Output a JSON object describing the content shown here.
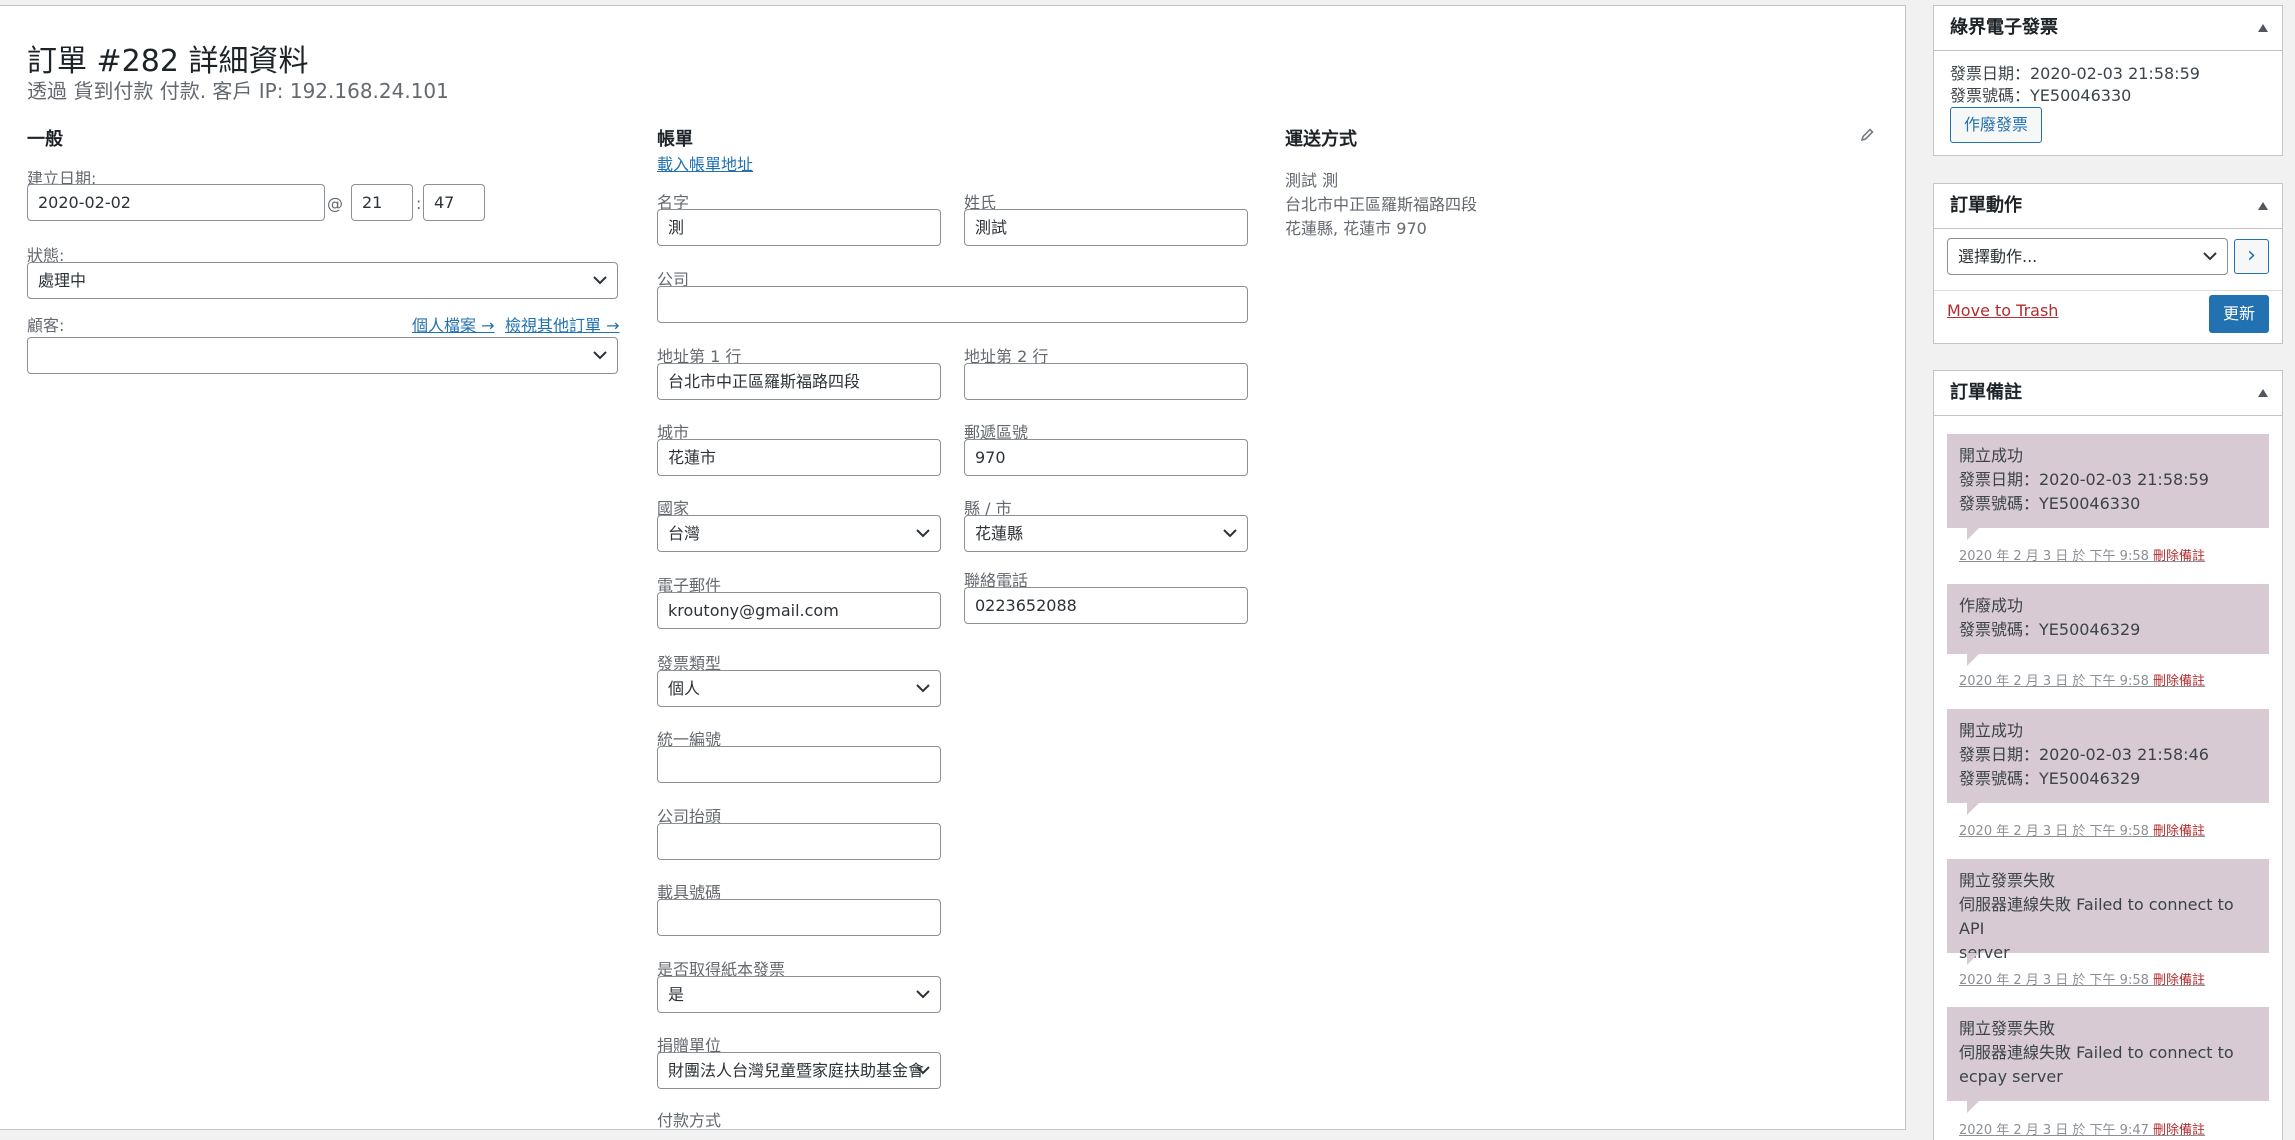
{
  "order": {
    "title": "訂單 #282 詳細資料",
    "subtitle": "透過 貨到付款 付款. 客戶 IP: 192.168.24.101"
  },
  "general": {
    "heading": "一般",
    "created_label": "建立日期:",
    "created_date": "2020-02-02",
    "at": "@",
    "hour": "21",
    "colon": ":",
    "minute": "47",
    "status_label": "狀態:",
    "status_value": "處理中",
    "customer_label": "顧客:",
    "profile_link": "個人檔案 →",
    "other_orders_link": "檢視其他訂單 →",
    "customer_value": ""
  },
  "billing": {
    "heading": "帳單",
    "load_address": "載入帳單地址",
    "first_name_label": "名字",
    "first_name": "測",
    "last_name_label": "姓氏",
    "last_name": "測試",
    "company_label": "公司",
    "company": "",
    "address1_label": "地址第 1 行",
    "address1": "台北市中正區羅斯福路四段",
    "address2_label": "地址第 2 行",
    "address2": "",
    "city_label": "城市",
    "city": "花蓮市",
    "postcode_label": "郵遞區號",
    "postcode": "970",
    "country_label": "國家",
    "country": "台灣",
    "state_label": "縣 / 市",
    "state": "花蓮縣",
    "email_label": "電子郵件",
    "email": "kroutony@gmail.com",
    "phone_label": "聯絡電話",
    "phone": "0223652088",
    "invoice_type_label": "發票類型",
    "invoice_type": "個人",
    "tax_id_label": "統一編號",
    "tax_id": "",
    "company_title_label": "公司抬頭",
    "company_title": "",
    "carrier_label": "載具號碼",
    "carrier": "",
    "paper_invoice_label": "是否取得紙本發票",
    "paper_invoice": "是",
    "donation_label": "捐贈單位",
    "donation": "財團法人台灣兒童暨家庭扶助基金會",
    "payment_label": "付款方式"
  },
  "shipping": {
    "heading": "運送方式",
    "name": "測試 測",
    "address": "台北市中正區羅斯福路四段",
    "city_line": "花蓮縣, 花蓮市 970"
  },
  "sidebar": {
    "einvoice": {
      "title": "綠界電子發票",
      "date_line": "發票日期：2020-02-03 21:58:59",
      "number_line": "發票號碼：YE50046330",
      "void_button": "作廢發票"
    },
    "actions": {
      "title": "訂單動作",
      "select_value": "選擇動作...",
      "go_button": "›",
      "trash_link": "Move to Trash",
      "update_button": "更新"
    },
    "notes": {
      "title": "訂單備註",
      "items": [
        {
          "lines": [
            "開立成功",
            "發票日期：2020-02-03 21:58:59",
            "發票號碼：YE50046330"
          ],
          "meta": "2020 年 2 月 3 日 於 下午 9:58",
          "delete": "刪除備註"
        },
        {
          "lines": [
            "作廢成功",
            "發票號碼：YE50046329"
          ],
          "meta": "2020 年 2 月 3 日 於 下午 9:58",
          "delete": "刪除備註"
        },
        {
          "lines": [
            "開立成功",
            "發票日期：2020-02-03 21:58:46",
            "發票號碼：YE50046329"
          ],
          "meta": "2020 年 2 月 3 日 於 下午 9:58",
          "delete": "刪除備註"
        },
        {
          "lines": [
            "開立發票失敗",
            "伺服器連線失敗 Failed to connect to API",
            "server"
          ],
          "meta": "2020 年 2 月 3 日 於 下午 9:58",
          "delete": "刪除備註"
        },
        {
          "lines": [
            "開立發票失敗",
            "伺服器連線失敗 Failed to connect to",
            "ecpay server"
          ],
          "meta": "2020 年 2 月 3 日 於 下午 9:47",
          "delete": "刪除備註"
        }
      ]
    }
  },
  "colors": {
    "link": "#2271b1",
    "primary_button": "#2271b1",
    "danger": "#b32d2e",
    "note_bg": "#d7cad2"
  }
}
